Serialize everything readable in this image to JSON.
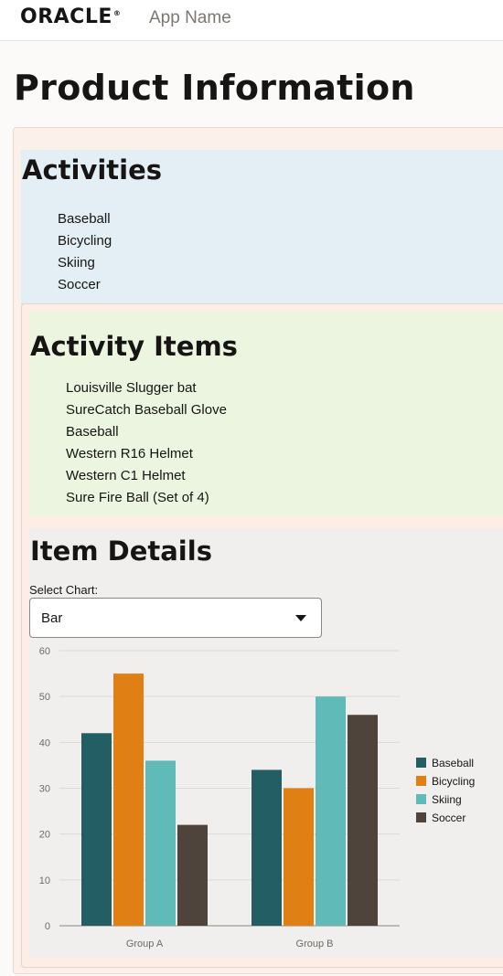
{
  "header": {
    "brand": "ORACLE",
    "brand_mark": "®",
    "app_name": "App Name"
  },
  "page": {
    "title": "Product Information"
  },
  "activities": {
    "title": "Activities",
    "items": [
      "Baseball",
      "Bicycling",
      "Skiing",
      "Soccer"
    ]
  },
  "activity_items": {
    "title": "Activity Items",
    "items": [
      "Louisville Slugger bat",
      "SureCatch Baseball Glove",
      "Baseball",
      "Western R16 Helmet",
      "Western C1 Helmet",
      "Sure Fire Ball (Set of 4)"
    ]
  },
  "item_details": {
    "title": "Item Details",
    "select_label": "Select Chart:",
    "select_value": "Bar"
  },
  "chart_data": {
    "type": "bar",
    "categories": [
      "Group A",
      "Group B"
    ],
    "series": [
      {
        "name": "Baseball",
        "values": [
          42,
          34
        ],
        "color": "#235e65"
      },
      {
        "name": "Bicycling",
        "values": [
          55,
          30
        ],
        "color": "#e07f13"
      },
      {
        "name": "Skiing",
        "values": [
          36,
          50
        ],
        "color": "#5fbab8"
      },
      {
        "name": "Soccer",
        "values": [
          22,
          46
        ],
        "color": "#4e443c"
      }
    ],
    "yticks": [
      0,
      10,
      20,
      30,
      40,
      50,
      60
    ],
    "ylim": [
      0,
      60
    ],
    "grid": true,
    "legend_position": "right"
  }
}
